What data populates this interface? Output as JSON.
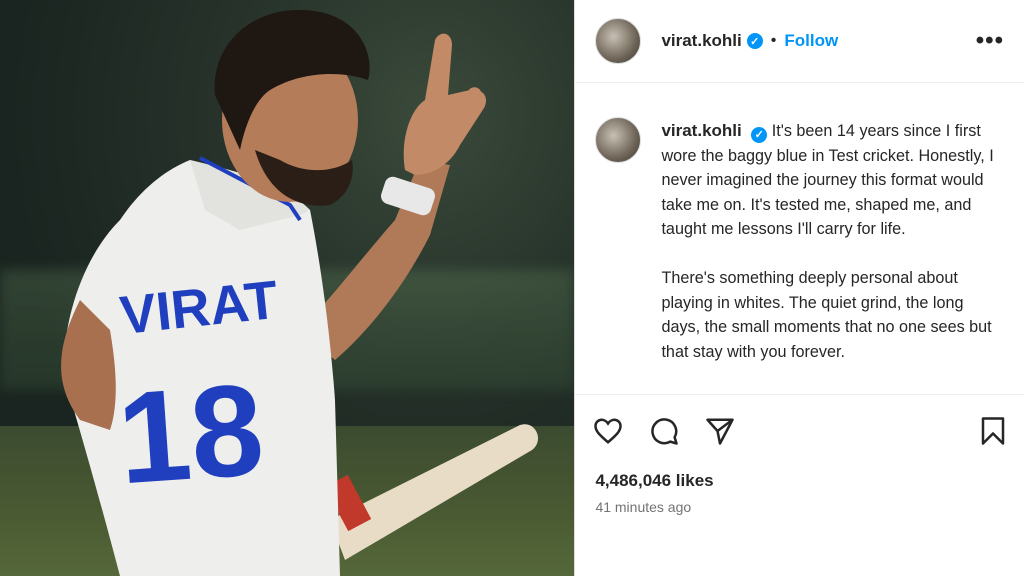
{
  "post": {
    "username": "virat.kohli",
    "follow_label": "Follow",
    "separator": "•",
    "more_label": "•••",
    "caption_p1": "It's been 14 years since I first wore the baggy blue in Test cricket. Honestly, I never imagined the journey this format would take me on. It's tested me, shaped me, and taught me lessons I'll carry for life.",
    "caption_p2": "There's something deeply personal about playing in whites. The quiet grind, the long days, the small moments that no one sees but that stay with you forever.",
    "likes": "4,486,046 likes",
    "time": "41 minutes ago"
  },
  "photo": {
    "jersey_name": "VIRAT",
    "jersey_number": "18"
  },
  "icons": [
    "heart-icon",
    "comment-icon",
    "share-icon",
    "bookmark-icon",
    "verified-icon",
    "more-icon"
  ],
  "colors": {
    "accent": "#0095f6",
    "text": "#262626",
    "muted": "#737373"
  }
}
